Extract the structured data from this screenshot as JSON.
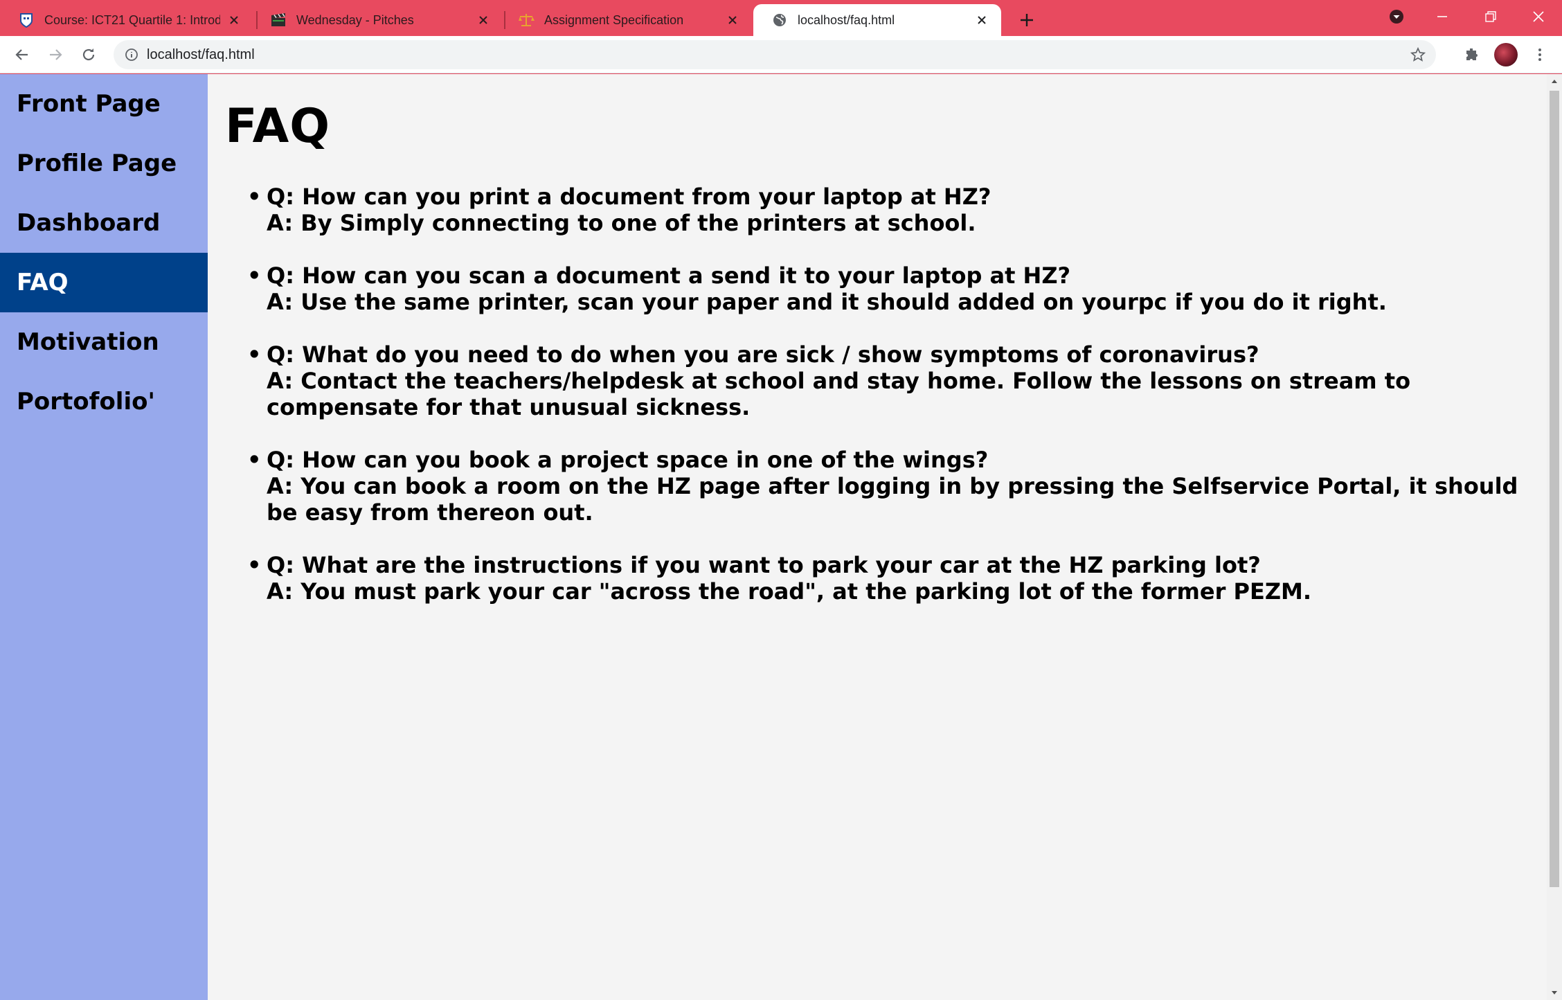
{
  "browser": {
    "tabs": [
      {
        "title": "Course: ICT21 Quartile 1: Introdu",
        "favicon": "hz-shield-icon",
        "active": false
      },
      {
        "title": "Wednesday - Pitches",
        "favicon": "clapperboard-icon",
        "active": false
      },
      {
        "title": "Assignment Specification",
        "favicon": "scales-icon",
        "active": false
      },
      {
        "title": "localhost/faq.html",
        "favicon": "globe-icon",
        "active": true
      }
    ],
    "url": "localhost/faq.html",
    "colors": {
      "tabstrip": "#e84a5f",
      "toolbar": "#ffffff"
    }
  },
  "sidebar": {
    "items": [
      {
        "label": "Front Page",
        "active": false
      },
      {
        "label": "Profile Page",
        "active": false
      },
      {
        "label": "Dashboard",
        "active": false
      },
      {
        "label": "FAQ",
        "active": true
      },
      {
        "label": "Motivation",
        "active": false
      },
      {
        "label": "Portofolio'",
        "active": false
      }
    ],
    "colors": {
      "background": "#97a9ec",
      "active": "#00418a"
    }
  },
  "main": {
    "title": "FAQ",
    "faq": [
      {
        "q": "Q: How can you print a document from your laptop at HZ?",
        "a": "A: By Simply connecting to one of the printers at school."
      },
      {
        "q": "Q: How can you scan a document a send it to your laptop at HZ?",
        "a": "A: Use the same printer, scan your paper and it should added on yourpc if you do it right."
      },
      {
        "q": "Q: What do you need to do when you are sick / show symptoms of coronavirus?",
        "a": "A: Contact the teachers/helpdesk at school and stay home. Follow the lessons on stream to compensate for that unusual sickness."
      },
      {
        "q": "Q: How can you book a project space in one of the wings?",
        "a": "A: You can book a room on the HZ page after logging in by pressing the Selfservice Portal, it should be easy from thereon out."
      },
      {
        "q": "Q: What are the instructions if you want to park your car at the HZ parking lot?",
        "a": "A: You must park your car \"across the road\", at the parking lot of the former PEZM."
      }
    ]
  }
}
